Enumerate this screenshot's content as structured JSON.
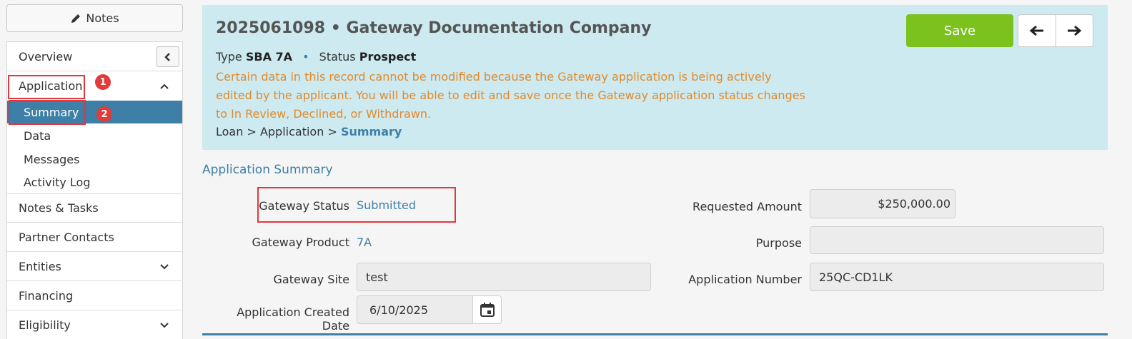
{
  "sidebar": {
    "notes_label": "Notes",
    "nav": [
      {
        "label": "Overview"
      },
      {
        "label": "Application"
      },
      {
        "label": "Notes & Tasks"
      },
      {
        "label": "Partner Contacts"
      },
      {
        "label": "Entities"
      },
      {
        "label": "Financing"
      },
      {
        "label": "Eligibility"
      }
    ],
    "sub_items": [
      {
        "label": "Summary",
        "active": true
      },
      {
        "label": "Data"
      },
      {
        "label": "Messages"
      },
      {
        "label": "Activity Log"
      }
    ],
    "badges": [
      "1",
      "2"
    ]
  },
  "header": {
    "title": "2025061098 • Gateway Documentation Company",
    "type_label": "Type",
    "type_value": "SBA 7A",
    "status_label": "Status",
    "status_value": "Prospect",
    "warning": "Certain data in this record cannot be modified because the Gateway application is being actively edited by the applicant. You will be able to edit and save once the Gateway application status changes to In Review, Declined, or Withdrawn.",
    "breadcrumb": {
      "part1": "Loan",
      "part2": "Application",
      "current": "Summary"
    },
    "save_label": "Save"
  },
  "summary": {
    "section_title": "Application Summary",
    "gateway_status_label": "Gateway Status",
    "gateway_status_value": "Submitted",
    "gateway_product_label": "Gateway Product",
    "gateway_product_value": "7A",
    "gateway_site_label": "Gateway Site",
    "gateway_site_value": "test",
    "created_date_label": "Application Created Date",
    "created_date_value": "6/10/2025",
    "requested_amount_label": "Requested Amount",
    "requested_amount_value": "$250,000.00",
    "purpose_label": "Purpose",
    "purpose_value": "",
    "app_number_label": "Application Number",
    "app_number_value": "25QC-CD1LK"
  },
  "colors": {
    "accent": "#3d7fa6",
    "save": "#7cc21e",
    "warning": "#e08a2b",
    "header_bg": "#cdeaf1",
    "highlight": "#e0383c"
  }
}
